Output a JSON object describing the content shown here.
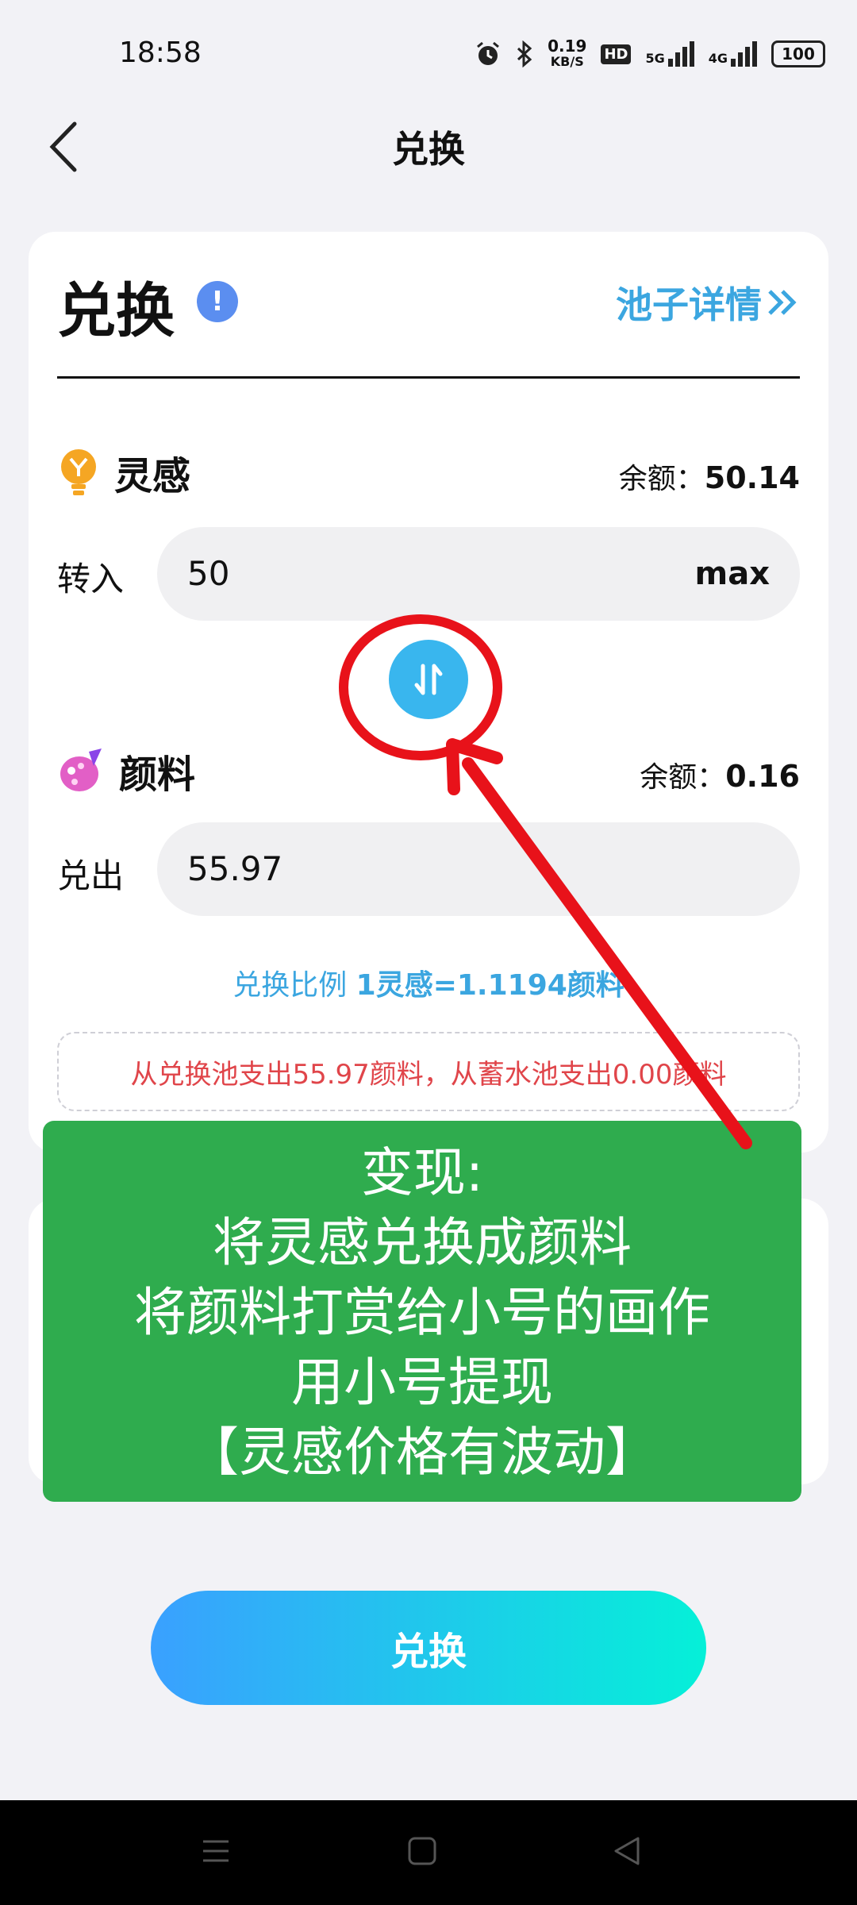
{
  "status_bar": {
    "time": "18:58",
    "net_speed_value": "0.19",
    "net_speed_unit": "KB/S",
    "hd_label": "HD",
    "sim1_label": "5G",
    "sim2_label": "4G",
    "battery": "100",
    "icons": [
      "alarm-icon",
      "bluetooth-icon"
    ]
  },
  "header": {
    "title": "兑换"
  },
  "card": {
    "title": "兑换",
    "info_icon": "!",
    "pool_link": "池子详情",
    "pool_link_icon": "double-chevron-right-icon"
  },
  "from_token": {
    "name": "灵感",
    "icon": "lightbulb-icon",
    "balance_label": "余额：",
    "balance_value": "50.14",
    "field_label": "转入",
    "amount": "50",
    "max_label": "max"
  },
  "to_token": {
    "name": "颜料",
    "icon": "palette-icon",
    "balance_label": "余额：",
    "balance_value": "0.16",
    "field_label": "兑出",
    "amount": "55.97"
  },
  "ratio": {
    "label": "兑换比例",
    "value": "1灵感=1.1194颜料"
  },
  "notice": "从兑换池支出55.97颜料，从蓄水池支出0.00颜料",
  "annotation": {
    "lines": [
      "变现:",
      "将灵感兑换成颜料",
      "将颜料打赏给小号的画作",
      "用小号提现",
      "【灵感价格有波动】"
    ],
    "colors": {
      "box": "#2fac4e",
      "ring": "#e8121a"
    }
  },
  "primary_button": "兑换",
  "colors": {
    "accent": "#3ba6e0",
    "warning": "#e0454a"
  }
}
